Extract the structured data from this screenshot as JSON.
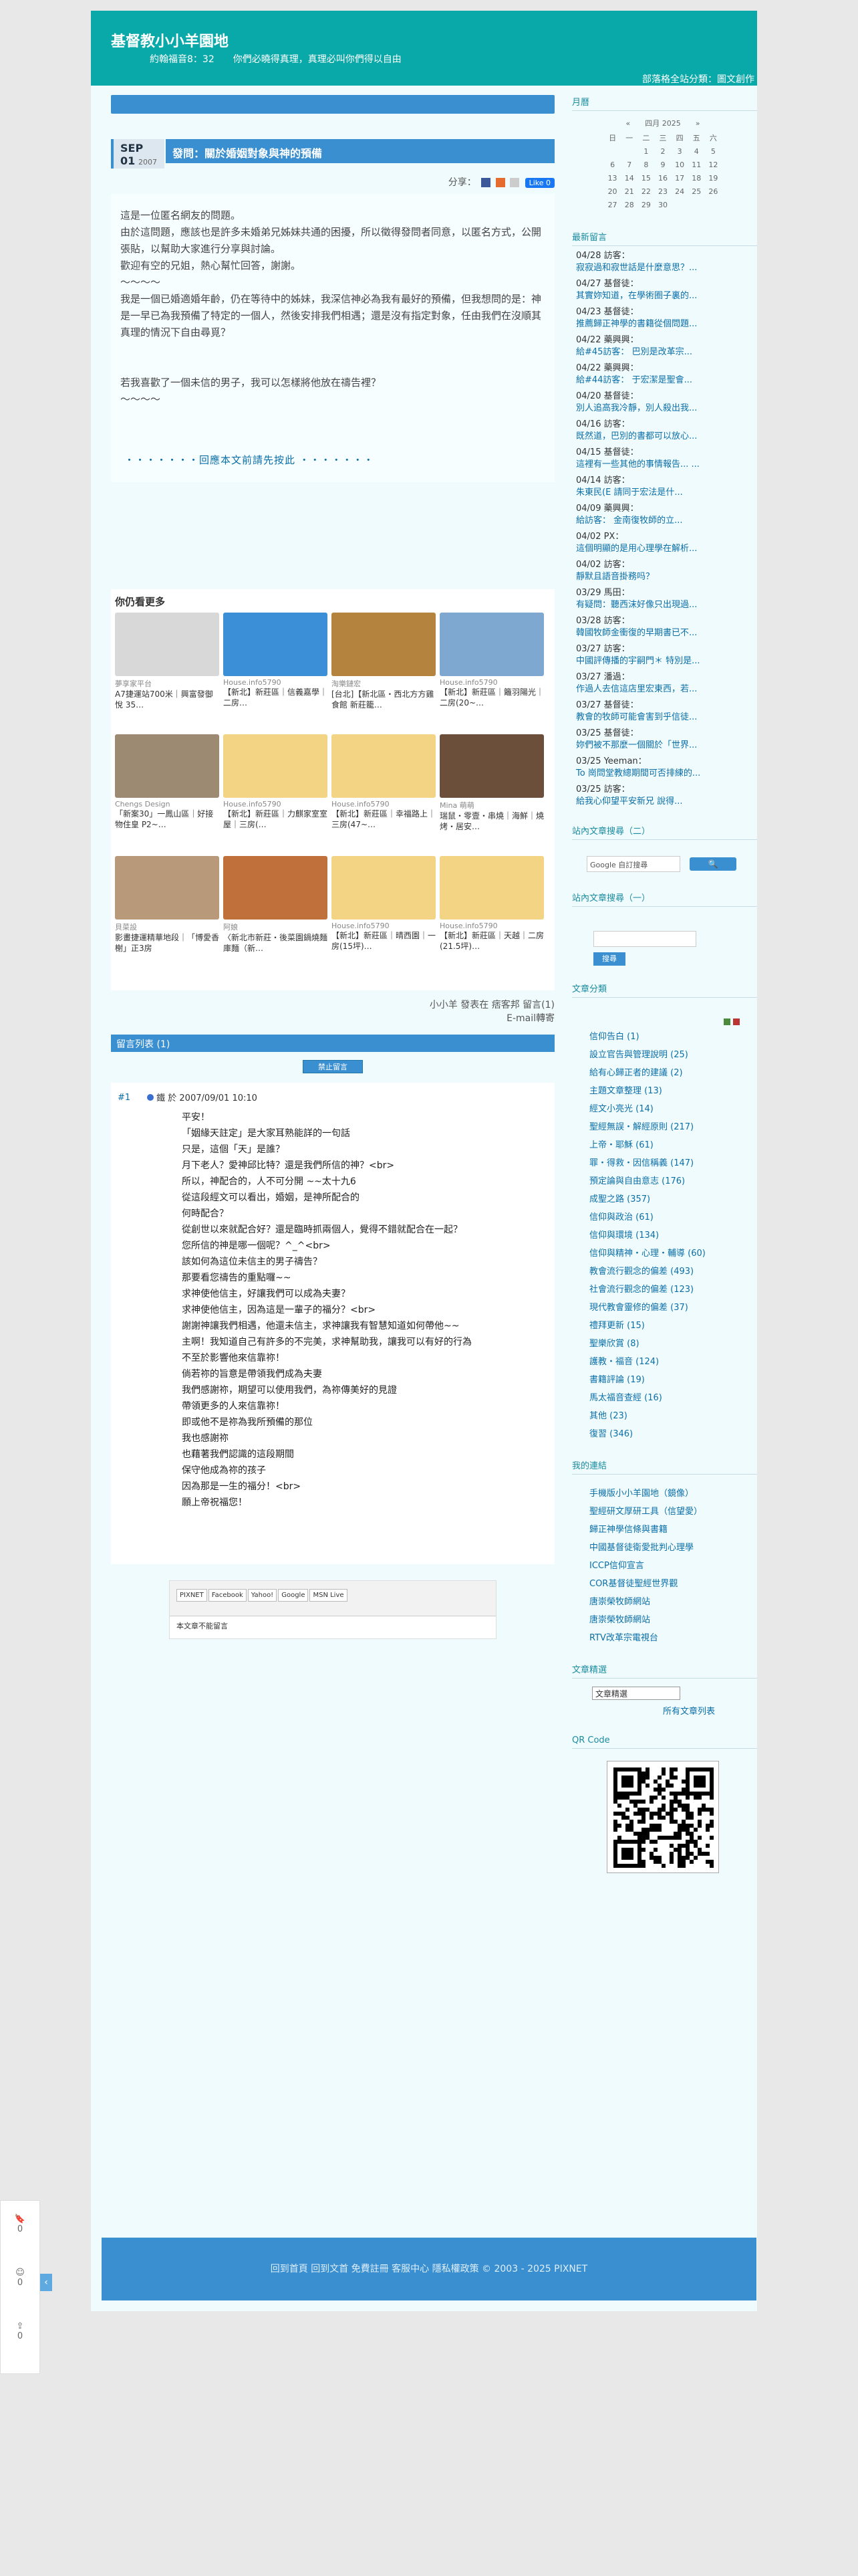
{
  "blog": {
    "title": "基督教小小羊園地",
    "description": "約翰福音8：32　　你們必曉得真理，真理必叫你們得以自由",
    "category_link": "部落格全站分類：圖文創作"
  },
  "post": {
    "month": "SEP",
    "day": "01",
    "year": "2007",
    "title": "發問：關於婚姻對象與神的預備",
    "share_label": "分享：",
    "like_label": "Like 0",
    "body": [
      "這是一位匿名網友的問題。",
      "由於這問題，應該也是許多未婚弟兄姊妹共通的困擾，所以徵得發問者同意，以匿名方式，公開張貼，以幫助大家進行分享與討論。",
      "歡迎有空的兄姐，熱心幫忙回答，謝謝。",
      "～～～～",
      "我是一個已婚適婚年齡，仍在等待中的姊妹，我深信神必為我有最好的預備，但我想問的是：神是一早已為我預備了特定的一個人，然後安排我們相遇；還是沒有指定對象，任由我們在沒順其真理的情況下自由尋覓？",
      "",
      "若我喜歡了一個未信的男子，我可以怎樣將他放在禱告裡？",
      "～～～～"
    ],
    "read_more": "・・・・・・・回應本文前請先按此 ・・・・・・・",
    "author_line": "小小羊 發表在 痞客邦 留言(1)",
    "email_label": "E-mail轉寄"
  },
  "more": {
    "title": "你仍看更多",
    "cards": [
      {
        "src": "夢享家平台",
        "title": "A7捷運站700米｜興富發御悅 35…",
        "color": "#d8d8d8"
      },
      {
        "src": "House.info5790",
        "title": "【新北】新莊區｜信義嘉學｜二房…",
        "color": "#3b8fd6"
      },
      {
        "src": "淘樂鏈宏",
        "title": "[台北]【新北區・西北方方雞食館 新莊籠…",
        "color": "#b4843e"
      },
      {
        "src": "House.info5790",
        "title": "【新北】新莊區｜籬羽陽光｜二房(20~…",
        "color": "#7fa8d0"
      },
      {
        "src": "Chengs Design",
        "title": "「新案30」一鳳山區｜好接物住皇 P2~…",
        "color": "#9c8a72"
      },
      {
        "src": "House.info5790",
        "title": "【新北】新莊區｜力麒家室室屋｜三房(…",
        "color": "#f2d484"
      },
      {
        "src": "House.info5790",
        "title": "【新北】新莊區｜幸福路上｜三房(47~…",
        "color": "#f2d484"
      },
      {
        "src": "Mina 萌萌",
        "title": "瑞鼠・零壹・串燒｜海鮮｜燒烤・居安…",
        "color": "#6b4f3a"
      },
      {
        "src": "貝菜設",
        "title": "影畫捷運精華地段｜「博愛香榭」正3房",
        "color": "#b89a7a"
      },
      {
        "src": "阿娘",
        "title": "〈新北市新莊・後菜園鍋燒麵庫麵（新…",
        "color": "#c0703a"
      },
      {
        "src": "House.info5790",
        "title": "【新北】新莊區｜晴西園｜一房(15坪)…",
        "color": "#f2d484"
      },
      {
        "src": "House.info5790",
        "title": "【新北】新莊區｜天越｜二房(21.5坪)…",
        "color": "#f2d484"
      }
    ]
  },
  "comments": {
    "header": "留言列表 (1)",
    "block_label": "禁止留言",
    "number": "#1",
    "meta": "  鐵 於 2007/09/01 10:10",
    "text": [
      "平安！",
      "「姻緣天註定」是大家耳熟能詳的一句話",
      "只是，這個「天」是誰？",
      "月下老人？愛神邱比特？還是我們所信的神？<br>",
      "所以，神配合的，人不可分開 ~~太十九6",
      "從這段經文可以看出，婚姻，是神所配合的",
      "何時配合？",
      "從創世以來就配合好？還是臨時抓兩個人，覺得不錯就配合在一起？",
      "您所信的神是哪一個呢？^_^<br>",
      "該如何為這位未信主的男子禱告？",
      "那要看您禱告的重點囉~~",
      "求神使他信主，好讓我們可以成為夫妻？",
      "求神使他信主，因為這是一輩子的福分？<br>",
      "謝謝神讓我們相遇，他還未信主，求神讓我有智慧知道如何帶他~~",
      "主啊！我知道自己有許多的不完美，求神幫助我，讓我可以有好的行為",
      "不至於影響他來信靠祢！",
      "倘若祢的旨意是帶領我們成為夫妻",
      "我們感謝祢，期望可以使用我們，為祢傳美好的見證",
      "帶領更多的人來信靠祢！",
      "即或他不是祢為我所預備的那位",
      "我也感謝祢",
      "也藉著我們認識的這段期間",
      "保守他成為祢的孩子",
      "因為那是一生的福分！<br>",
      "願上帝祝福您！"
    ],
    "social": [
      "PIXNET",
      "Facebook",
      "Yahoo!",
      "Google",
      "MSN Live"
    ],
    "no_comment": "本文章不能留言"
  },
  "sidebar": {
    "calendar_title": "月曆",
    "calendar_header": "«　　四月 2025　　»",
    "weekdays": [
      "日",
      "一",
      "二",
      "三",
      "四",
      "五",
      "六"
    ],
    "weeks": [
      [
        "",
        "",
        "1",
        "2",
        "3",
        "4",
        "5"
      ],
      [
        "6",
        "7",
        "8",
        "9",
        "10",
        "11",
        "12"
      ],
      [
        "13",
        "14",
        "15",
        "16",
        "17",
        "18",
        "19"
      ],
      [
        "20",
        "21",
        "22",
        "23",
        "24",
        "25",
        "26"
      ],
      [
        "27",
        "28",
        "29",
        "30",
        "",
        "",
        ""
      ]
    ],
    "messages_title": "最新留言",
    "messages": [
      {
        "who": "04/28 訪客：",
        "txt": "寂寂過和寂世話是什麼意思？..."
      },
      {
        "who": "04/27 基督徒：",
        "txt": "其實妳知道，在學術圈子裏的..."
      },
      {
        "who": "04/23 基督徒：",
        "txt": "推薦歸正神學的書籍從個問題..."
      },
      {
        "who": "04/22 藥興興：",
        "txt": "給#45訪客： 巴別是改革宗..."
      },
      {
        "who": "04/22 藥興興：",
        "txt": "給#44訪客： 于宏潔是聖會..."
      },
      {
        "who": "04/20 基督徒：",
        "txt": "別人追高我冷靜，別人殺出我..."
      },
      {
        "who": "04/16 訪客：",
        "txt": "既然道，巴別的書都可以放心..."
      },
      {
        "who": "04/15 基督徒：",
        "txt": "這裡有一些其他的事情報告...  ..."
      },
      {
        "who": "04/14 訪客：",
        "txt": "朱東民(E 請同于宏法是什..."
      },
      {
        "who": "04/09 藥興興：",
        "txt": "給訪客： 金南復牧師的立..."
      },
      {
        "who": "04/02 PX：",
        "txt": "這個明顯的是用心理學在解析..."
      },
      {
        "who": "04/02 訪客：",
        "txt": "靜默且語音掛務吗？"
      },
      {
        "who": "03/29 馬田：",
        "txt": "有疑問：聽西沫好像只出現過..."
      },
      {
        "who": "03/28 訪客：",
        "txt": "韓國牧師金衝復的早期書已不..."
      },
      {
        "who": "03/27 訪客：",
        "txt": "中國評傳播的宇嗣門＊ 特別是..."
      },
      {
        "who": "03/27 潘過：",
        "txt": "作過人去信這店里宏東西，若..."
      },
      {
        "who": "03/27 基督徒：",
        "txt": "教會的牧師可能會害到乎信徒..."
      },
      {
        "who": "03/25 基督徒：",
        "txt": "妳們被不那麼一個關於「世界..."
      },
      {
        "who": "03/25 Yeeman：",
        "txt": "To 崗問堂教總期間可否排練的..."
      },
      {
        "who": "03/25 訪客：",
        "txt": "給我心仰望平安新兄 說得..."
      }
    ],
    "search_title": "站內文章搜尋（二）",
    "search_placeholder": "Google 自訂搜尋",
    "search2_title": "站內文章搜尋（一）",
    "search2_button": "搜尋",
    "categories_title": "文章分類",
    "categories": [
      "信仰告白 (1)",
      "設立官告與管理說明 (25)",
      "給有心歸正者的建議 (2)",
      "主題文章整理 (13)",
      "經文小亮光 (14)",
      "聖經無誤・解經原則 (217)",
      "上帝・耶穌 (61)",
      "罪・得救・因信稱義 (147)",
      "預定論與自由意志 (176)",
      "成聖之路 (357)",
      "信仰與政治 (61)",
      "信仰與環境 (134)",
      "信仰與精神・心理・輔導 (60)",
      "教會流行觀念的偏差 (493)",
      "社會流行觀念的偏差 (123)",
      "現代教會靈修的偏差 (37)",
      "禮拜更新 (15)",
      "聖樂欣賞 (8)",
      "護教・福音 (124)",
      "書籍評論 (19)",
      "馬太福音查經 (16)",
      "其他 (23)",
      "復習 (346)"
    ],
    "links_title": "我的連結",
    "links": [
      "手機版小小羊園地（鏡像）",
      "聖經研文厚研工具（信望愛）",
      "歸正神學信條與書籍",
      "中國基督徒衛愛批判心理學",
      "ICCP信仰宣言",
      "COR基督徒聖經世界觀",
      "唐崇榮牧師網站",
      "唐崇榮牧師網站",
      "RTV改革宗電視台"
    ],
    "archive_title": "文章精選",
    "archive_select": "文章精選",
    "all_posts": "所有文章列表",
    "qr_title": "QR Code"
  },
  "footer": {
    "links": "回到首頁 回到文首 免費註冊 客服中心 隱私權政策",
    "copyright": "© 2003 - 2025 PIXNET"
  },
  "float": {
    "bookmark_count": "0",
    "reaction_count": "0",
    "share_count": "0"
  },
  "colors": {
    "banner": "#0aa9a9",
    "accent": "#3a8fd0",
    "sidebar_title": "#1a8ca0",
    "link": "#0b6fa8"
  }
}
